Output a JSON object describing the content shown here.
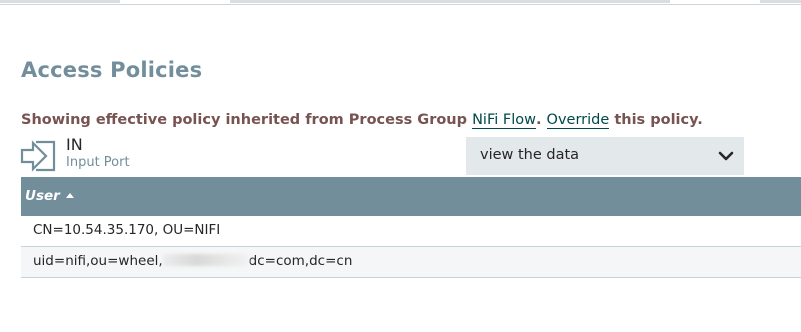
{
  "page": {
    "title": "Access Policies"
  },
  "message": {
    "prefix": "Showing effective policy inherited from Process Group ",
    "group_link": "NiFi Flow",
    "separator": ". ",
    "override_link": "Override",
    "suffix": " this policy."
  },
  "component": {
    "name": "IN",
    "type": "Input Port",
    "icon": "input-port-icon"
  },
  "policy_select": {
    "selected": "view the data",
    "icon": "chevron-down-icon"
  },
  "table": {
    "columns": [
      {
        "label": "User",
        "sort": "ascending"
      }
    ],
    "rows": [
      {
        "user": "CN=10.54.35.170, OU=NIFI"
      },
      {
        "user_before_redaction": "uid=nifi,ou=wheel,",
        "user_after_redaction": "dc=com,dc=cn"
      }
    ]
  },
  "colors": {
    "title": "#728e9b",
    "message": "#775351",
    "link": "#004849",
    "table_header": "#728e9b",
    "select_bg": "#e3e8eb"
  }
}
